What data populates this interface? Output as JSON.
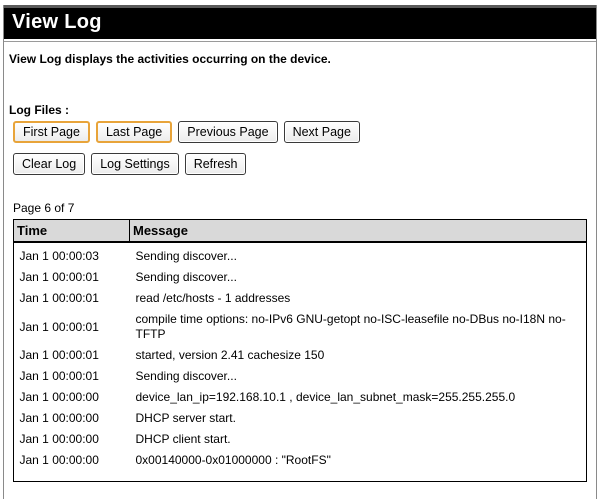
{
  "page": {
    "title": "View Log",
    "description": "View Log displays the activities occurring on the device."
  },
  "log_files": {
    "label": "Log Files :",
    "buttons_row1": [
      {
        "label": "First Page",
        "highlighted": true
      },
      {
        "label": "Last Page",
        "highlighted": true
      },
      {
        "label": "Previous Page",
        "highlighted": false
      },
      {
        "label": "Next Page",
        "highlighted": false
      }
    ],
    "buttons_row2": [
      {
        "label": "Clear Log"
      },
      {
        "label": "Log Settings"
      },
      {
        "label": "Refresh"
      }
    ]
  },
  "pagination": {
    "text": "Page 6 of 7"
  },
  "table": {
    "headers": [
      "Time",
      "Message"
    ],
    "rows": [
      {
        "time": "Jan 1 00:00:03",
        "message": "Sending discover..."
      },
      {
        "time": "Jan 1 00:00:01",
        "message": "Sending discover..."
      },
      {
        "time": "Jan 1 00:00:01",
        "message": "read /etc/hosts - 1 addresses"
      },
      {
        "time": "Jan 1 00:00:01",
        "message": "compile time options: no-IPv6 GNU-getopt no-ISC-leasefile no-DBus no-I18N no-TFTP"
      },
      {
        "time": "Jan 1 00:00:01",
        "message": "started, version 2.41 cachesize 150"
      },
      {
        "time": "Jan 1 00:00:01",
        "message": "Sending discover..."
      },
      {
        "time": "Jan 1 00:00:00",
        "message": "device_lan_ip=192.168.10.1 , device_lan_subnet_mask=255.255.255.0"
      },
      {
        "time": "Jan 1 00:00:00",
        "message": "DHCP server start."
      },
      {
        "time": "Jan 1 00:00:00",
        "message": "DHCP client start."
      },
      {
        "time": "Jan 1 00:00:00",
        "message": "0x00140000-0x01000000 : \"RootFS\""
      }
    ]
  }
}
